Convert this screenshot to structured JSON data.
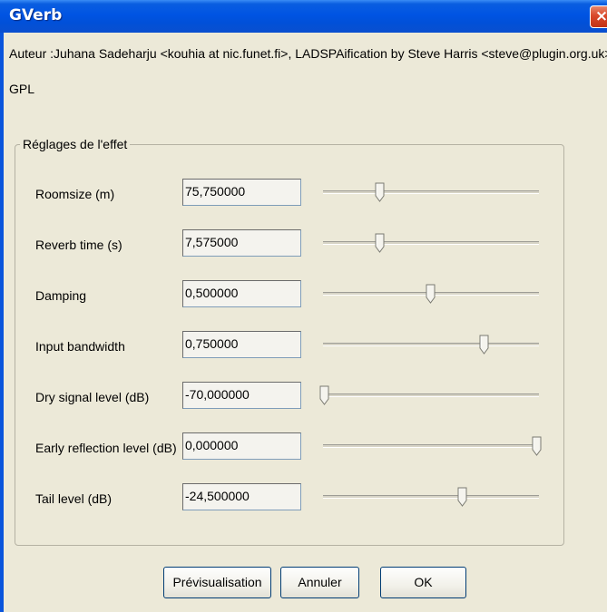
{
  "window": {
    "title": "GVerb",
    "close_glyph": "×"
  },
  "info": {
    "author": "Auteur :Juhana Sadeharju <kouhia at nic.funet.fi>, LADSPAification by Steve Harris <steve@plugin.org.uk>",
    "license": "GPL"
  },
  "group": {
    "title": "Réglages de l'effet"
  },
  "params": [
    {
      "label": "Roomsize (m)",
      "value": "75,750000",
      "level": 0.26
    },
    {
      "label": "Reverb time (s)",
      "value": "7,575000",
      "level": 0.26
    },
    {
      "label": "Damping",
      "value": "0,500000",
      "level": 0.5
    },
    {
      "label": "Input bandwidth",
      "value": "0,750000",
      "level": 0.75
    },
    {
      "label": "Dry signal level (dB)",
      "value": "-70,000000",
      "level": 0.0
    },
    {
      "label": "Early reflection level (dB)",
      "value": "0,000000",
      "level": 1.0
    },
    {
      "label": "Tail level (dB)",
      "value": "-24,500000",
      "level": 0.65
    }
  ],
  "buttons": {
    "preview": "Prévisualisation",
    "cancel": "Annuler",
    "ok": "OK"
  }
}
